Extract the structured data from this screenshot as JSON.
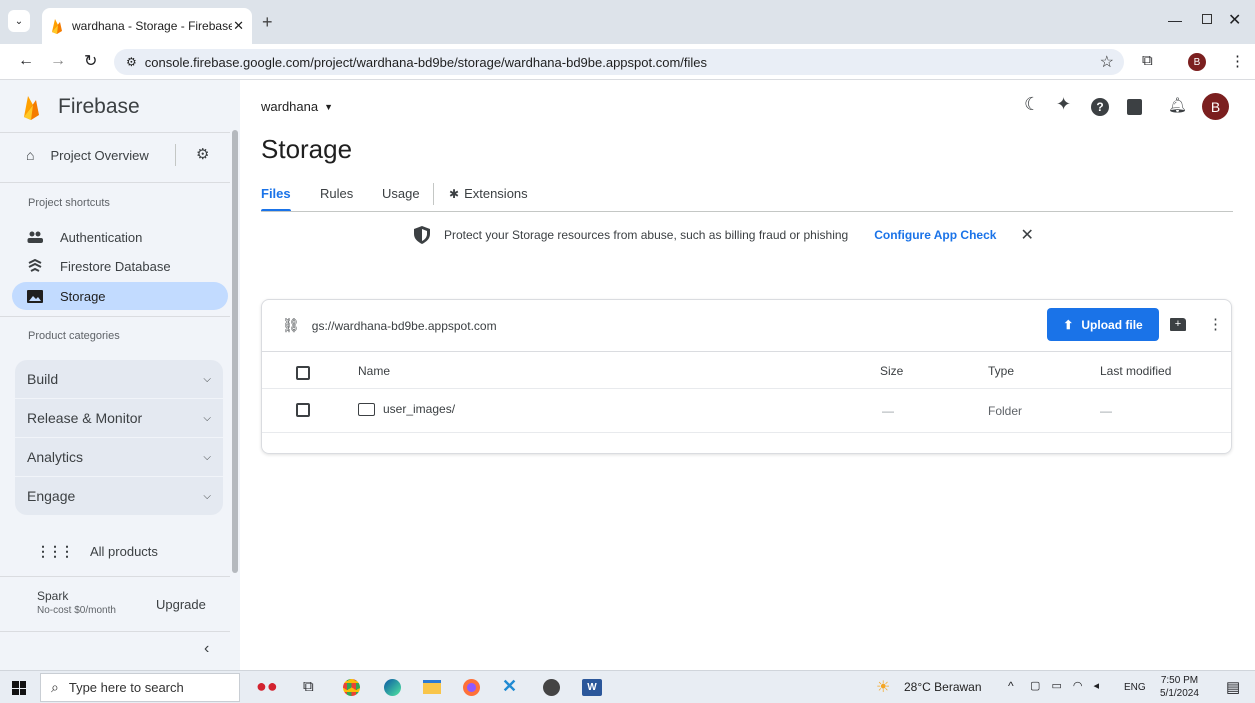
{
  "browser": {
    "tab_title": "wardhana - Storage - Firebase c",
    "url": "console.firebase.google.com/project/wardhana-bd9be/storage/wardhana-bd9be.appspot.com/files",
    "profile_initial": "B"
  },
  "sidebar": {
    "brand": "Firebase",
    "project_overview": "Project Overview",
    "shortcuts_label": "Project shortcuts",
    "shortcuts": [
      {
        "label": "Authentication",
        "icon": "people-icon"
      },
      {
        "label": "Firestore Database",
        "icon": "firestore-icon"
      },
      {
        "label": "Storage",
        "icon": "storage-icon",
        "active": true
      }
    ],
    "categories_label": "Product categories",
    "categories": [
      "Build",
      "Release & Monitor",
      "Analytics",
      "Engage"
    ],
    "all_products": "All products",
    "plan": {
      "name": "Spark",
      "desc": "No-cost $0/month",
      "upgrade": "Upgrade"
    },
    "collapse": "‹"
  },
  "header": {
    "project": "wardhana",
    "page_title": "Storage",
    "tabs": [
      "Files",
      "Rules",
      "Usage",
      "Extensions"
    ],
    "active_tab": "Files",
    "avatar": "B"
  },
  "banner": {
    "text": "Protect your Storage resources from abuse, such as billing fraud or phishing",
    "action": "Configure App Check"
  },
  "files": {
    "bucket": "gs://wardhana-bd9be.appspot.com",
    "upload": "Upload file",
    "columns": [
      "Name",
      "Size",
      "Type",
      "Last modified"
    ],
    "rows": [
      {
        "name": "user_images/",
        "size": "—",
        "type": "Folder",
        "modified": "—"
      }
    ]
  },
  "taskbar": {
    "search_placeholder": "Type here to search",
    "weather": "28°C  Berawan",
    "lang": "ENG",
    "time": "7:50 PM",
    "date": "5/1/2024"
  },
  "colors": {
    "accent": "#1a73e8",
    "active_item": "#c2dbff",
    "firebase_orange": "#f5a623"
  }
}
